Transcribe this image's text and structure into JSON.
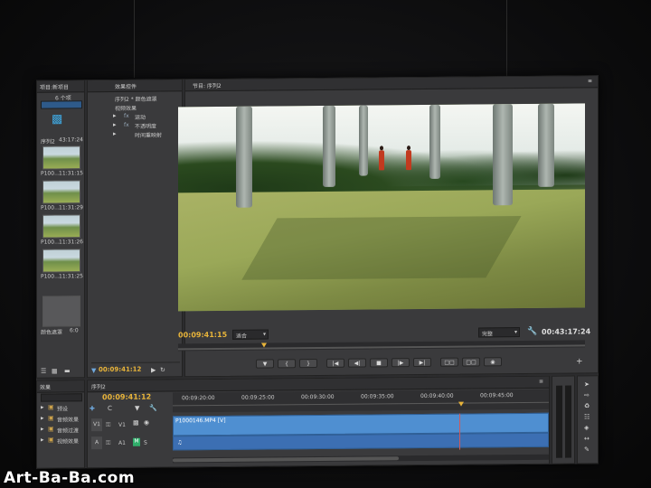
{
  "project_panel": {
    "tab": "项目:新项目",
    "items_count": "6 个项",
    "clips": [
      {
        "name": "序列2",
        "duration": "43:17:24"
      },
      {
        "name": "P100...",
        "duration": "11:31:15"
      },
      {
        "name": "P100...",
        "duration": "11:31:29"
      },
      {
        "name": "P100...",
        "duration": "11:31:26"
      },
      {
        "name": "P100...",
        "duration": "11:31:25"
      },
      {
        "name": "颜色遮罩",
        "duration": "6:0"
      }
    ]
  },
  "effect_controls": {
    "tab": "效果控件",
    "sequence_label": "序列2 * 颜色遮罩",
    "section": "视频效果",
    "effects": [
      "运动",
      "不透明度",
      "时间重映射"
    ],
    "timecode": "00:09:41:12"
  },
  "program_monitor": {
    "tab": "节目: 序列2",
    "timecode_in": "00:09:41:15",
    "fit_label": "适合",
    "quality_label": "完整",
    "timecode_total": "00:43:17:24"
  },
  "effects_panel": {
    "tab": "效果",
    "folders": [
      "预设",
      "音频效果",
      "音频过渡",
      "视频效果"
    ]
  },
  "timeline": {
    "tab": "序列2",
    "timecode": "00:09:41:12",
    "ruler": [
      "00:09:20:00",
      "00:09:25:00",
      "00:09:30:00",
      "00:09:35:00",
      "00:09:40:00",
      "00:09:45:00"
    ],
    "video_track": "V1",
    "audio_track": "A1",
    "video_source": "V1",
    "audio_source": "A",
    "clip_name": "P1000146.MP4 [V]",
    "audio_mark": "M",
    "audio_solo": "S"
  },
  "watermark": "Art-Ba-Ba.com",
  "colors": {
    "timecode_accent": "#e8b43a",
    "clip_video": "#4f8fd1",
    "clip_audio": "#3c6fb3"
  }
}
